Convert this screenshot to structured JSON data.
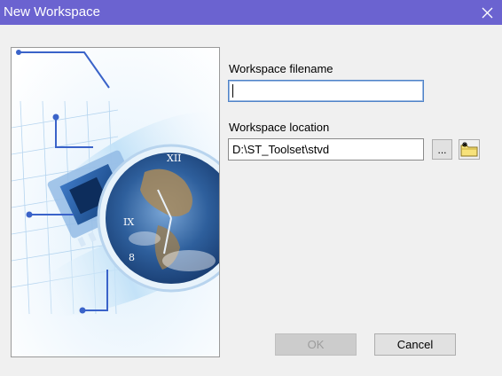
{
  "window": {
    "title": "New Workspace",
    "close_icon": "close-icon",
    "title_bar_color": "#6b63d0"
  },
  "form": {
    "filename_label": "Workspace filename",
    "filename_value": "",
    "location_label": "Workspace location",
    "location_value": "D:\\ST_Toolset\\stvd",
    "browse_label": "...",
    "new_folder_icon": "new-folder-icon"
  },
  "buttons": {
    "ok_label": "OK",
    "ok_enabled": false,
    "cancel_label": "Cancel"
  },
  "illustration": {
    "icon": "circuit-globe-clock-illustration"
  }
}
